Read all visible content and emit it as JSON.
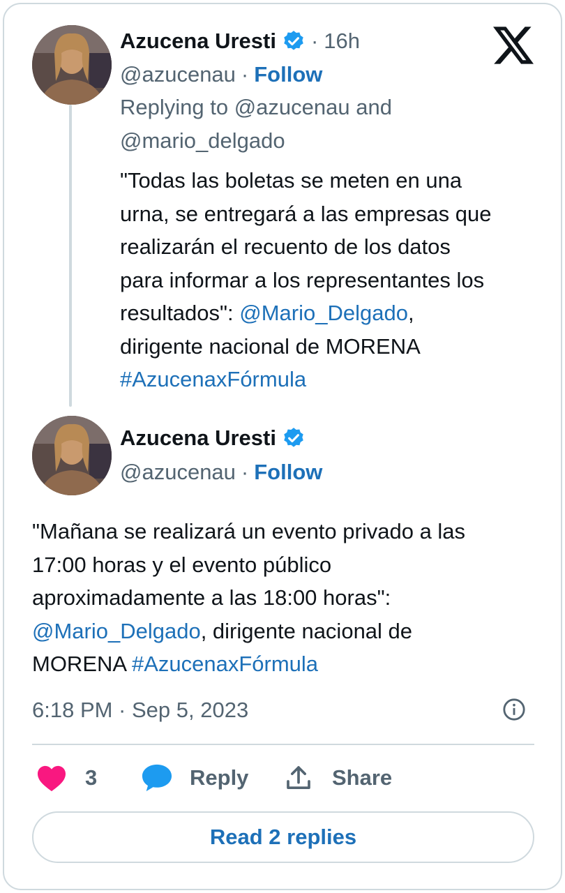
{
  "first_tweet": {
    "author_name": "Azucena Uresti",
    "time_ago": "16h",
    "handle": "@azucenau",
    "follow_label": "Follow",
    "replying_line1": "Replying to @azucenau and",
    "replying_line2": "@mario_delgado",
    "text_lines": [
      "\"Todas las boletas se meten en una",
      "urna, se entregará a las empresas que",
      "realizarán el recuento de los datos",
      "para informar a los representantes los"
    ],
    "line5_prefix": "resultados\": ",
    "line5_mention": "@Mario_Delgado",
    "line5_suffix": ",",
    "line6": "dirigente nacional de MORENA",
    "hashtag": "#AzucenaxFórmula"
  },
  "second_tweet": {
    "author_name": "Azucena Uresti",
    "handle": "@azucenau",
    "follow_label": "Follow",
    "text_lines": [
      "\"Mañana se realizará un evento privado a las",
      "17:00 horas y el evento público",
      "aproximadamente a las 18:00 horas\":"
    ],
    "line4_mention": "@Mario_Delgado",
    "line4_suffix": ", dirigente nacional de",
    "line5_prefix": "MORENA ",
    "hashtag": "#AzucenaxFórmula",
    "timestamp": "6:18 PM · Sep 5, 2023"
  },
  "actions": {
    "like_count": "3",
    "reply_label": "Reply",
    "share_label": "Share"
  },
  "read_replies_label": "Read 2 replies",
  "icons": {
    "logo": "x-logo-icon",
    "verified": "verified-badge-icon",
    "like": "heart-icon",
    "reply": "speech-bubble-icon",
    "share": "share-upload-icon",
    "info": "info-icon"
  },
  "colors": {
    "link": "#1d70b8",
    "verified": "#1d9bf0",
    "heart": "#f91880",
    "reply_bubble": "#1d9bf0",
    "muted": "#536471",
    "border": "#cfd9de"
  }
}
